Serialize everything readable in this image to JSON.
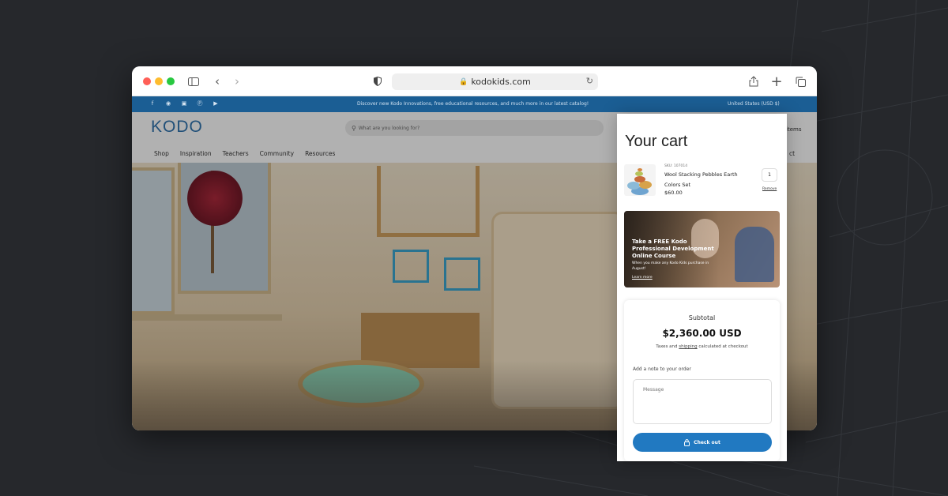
{
  "browser": {
    "url": "kodokids.com",
    "buttons": {
      "close_color": "#ff5f57",
      "minimize_color": "#febc2e",
      "zoom_color": "#28c840"
    }
  },
  "announcement": {
    "message": "Discover new Kodo Innovations, free educational resources, and much more in our latest catalog!",
    "region": "United States (USD $)",
    "socials": [
      "facebook-icon",
      "spotify-icon",
      "instagram-icon",
      "pinterest-icon",
      "youtube-icon"
    ]
  },
  "site": {
    "logo": "KODO",
    "search_placeholder": "What are you looking for?",
    "nav": [
      "Shop",
      "Inspiration",
      "Teachers",
      "Community",
      "Resources"
    ],
    "header_right_fragment": "items",
    "nav_right_fragment": "ct"
  },
  "cart": {
    "title": "Your cart",
    "item": {
      "sku": "SKU: 107014",
      "name": "Wool Stacking Pebbles Earth Colors Set",
      "price": "$60.00",
      "quantity": "1",
      "remove_label": "Remove"
    },
    "promo": {
      "headline": "Take a FREE Kodo Professional Development Online Course",
      "subtext": "When you make any Kodo Kids purchase in August!",
      "link": "Learn more"
    },
    "summary": {
      "subtotal_label": "Subtotal",
      "subtotal_value": "$2,360.00 USD",
      "tax_note_prefix": "Taxes and ",
      "tax_note_link": "shipping",
      "tax_note_suffix": " calculated at checkout",
      "note_label": "Add a note to your order",
      "note_placeholder": "Message",
      "checkout_label": "Check out"
    }
  },
  "colors": {
    "brand_blue": "#2179c1",
    "announcement_bar": "#1b5e94",
    "background": "#26282c"
  }
}
